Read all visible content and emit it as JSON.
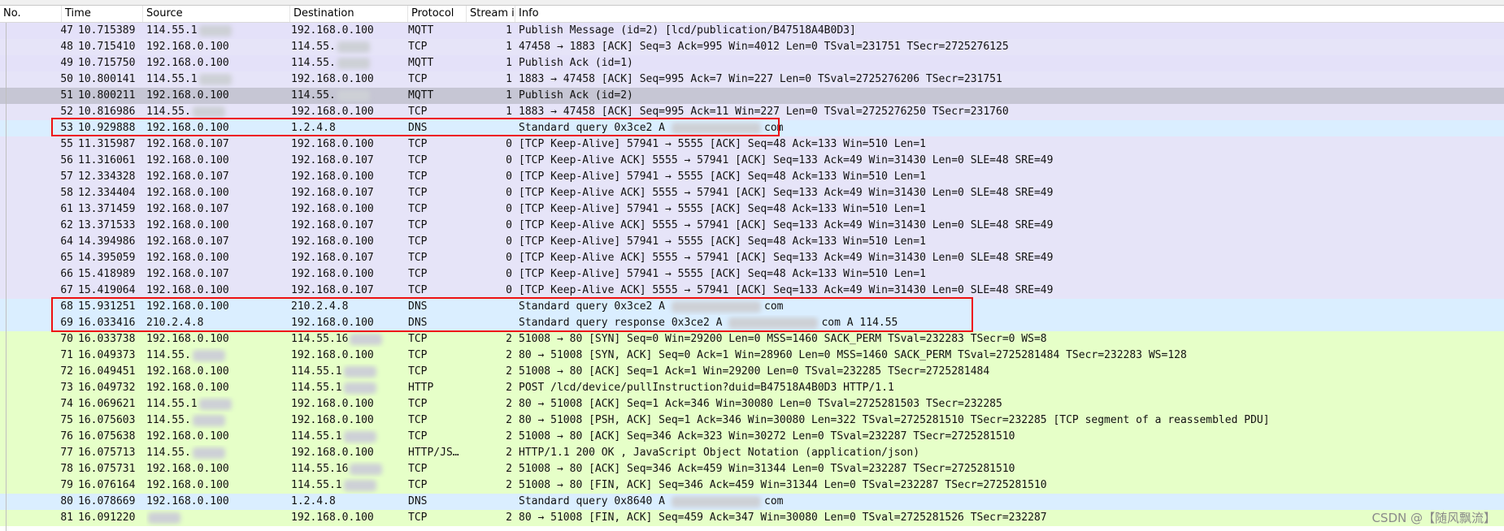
{
  "columns": [
    "No.",
    "Time",
    "Source",
    "Destination",
    "Protocol",
    "Stream in",
    "Info"
  ],
  "packets": [
    {
      "no": "47",
      "time": "10.715389",
      "src": "114.55.1",
      "dst": "192.168.0.100",
      "proto": "MQTT",
      "stream": "1",
      "info": "Publish Message (id=2) [lcd/publication/B47518A4B0D3]",
      "bg": "mqtt",
      "src_blur": true,
      "dst_blur": false
    },
    {
      "no": "48",
      "time": "10.715410",
      "src": "192.168.0.100",
      "dst": "114.55.",
      "proto": "TCP",
      "stream": "1",
      "info": "47458 → 1883 [ACK] Seq=3 Ack=995 Win=4012 Len=0 TSval=231751 TSecr=2725276125",
      "bg": "tcp",
      "src_blur": false,
      "dst_blur": true
    },
    {
      "no": "49",
      "time": "10.715750",
      "src": "192.168.0.100",
      "dst": "114.55.",
      "proto": "MQTT",
      "stream": "1",
      "info": "Publish Ack (id=1)",
      "bg": "mqtt",
      "src_blur": false,
      "dst_blur": true
    },
    {
      "no": "50",
      "time": "10.800141",
      "src": "114.55.1",
      "dst": "192.168.0.100",
      "proto": "TCP",
      "stream": "1",
      "info": "1883 → 47458 [ACK] Seq=995 Ack=7 Win=227 Len=0 TSval=2725276206 TSecr=231751",
      "bg": "tcp",
      "src_blur": true,
      "dst_blur": false
    },
    {
      "no": "51",
      "time": "10.800211",
      "src": "192.168.0.100",
      "dst": "114.55.",
      "proto": "MQTT",
      "stream": "1",
      "info": "Publish Ack (id=2)",
      "bg": "sel",
      "src_blur": false,
      "dst_blur": true
    },
    {
      "no": "52",
      "time": "10.816986",
      "src": "114.55.",
      "dst": "192.168.0.100",
      "proto": "TCP",
      "stream": "1",
      "info": "1883 → 47458 [ACK] Seq=995 Ack=11 Win=227 Len=0 TSval=2725276250 TSecr=231760",
      "bg": "tcp",
      "src_blur": true,
      "dst_blur": false
    },
    {
      "no": "53",
      "time": "10.929888",
      "src": "192.168.0.100",
      "dst": "1.2.4.8",
      "proto": "DNS",
      "stream": "",
      "info": "Standard query 0x3ce2 A",
      "info_tail": "com",
      "bg": "dns",
      "src_blur": false,
      "dst_blur": false,
      "info_blur": true
    },
    {
      "no": "55",
      "time": "11.315987",
      "src": "192.168.0.107",
      "dst": "192.168.0.100",
      "proto": "TCP",
      "stream": "0",
      "info": "[TCP Keep-Alive] 57941 → 5555 [ACK] Seq=48 Ack=133 Win=510 Len=1",
      "bg": "tcp"
    },
    {
      "no": "56",
      "time": "11.316061",
      "src": "192.168.0.100",
      "dst": "192.168.0.107",
      "proto": "TCP",
      "stream": "0",
      "info": "[TCP Keep-Alive ACK] 5555 → 57941 [ACK] Seq=133 Ack=49 Win=31430 Len=0 SLE=48 SRE=49",
      "bg": "tcp"
    },
    {
      "no": "57",
      "time": "12.334328",
      "src": "192.168.0.107",
      "dst": "192.168.0.100",
      "proto": "TCP",
      "stream": "0",
      "info": "[TCP Keep-Alive] 57941 → 5555 [ACK] Seq=48 Ack=133 Win=510 Len=1",
      "bg": "tcp"
    },
    {
      "no": "58",
      "time": "12.334404",
      "src": "192.168.0.100",
      "dst": "192.168.0.107",
      "proto": "TCP",
      "stream": "0",
      "info": "[TCP Keep-Alive ACK] 5555 → 57941 [ACK] Seq=133 Ack=49 Win=31430 Len=0 SLE=48 SRE=49",
      "bg": "tcp"
    },
    {
      "no": "61",
      "time": "13.371459",
      "src": "192.168.0.107",
      "dst": "192.168.0.100",
      "proto": "TCP",
      "stream": "0",
      "info": "[TCP Keep-Alive] 57941 → 5555 [ACK] Seq=48 Ack=133 Win=510 Len=1",
      "bg": "tcp"
    },
    {
      "no": "62",
      "time": "13.371533",
      "src": "192.168.0.100",
      "dst": "192.168.0.107",
      "proto": "TCP",
      "stream": "0",
      "info": "[TCP Keep-Alive ACK] 5555 → 57941 [ACK] Seq=133 Ack=49 Win=31430 Len=0 SLE=48 SRE=49",
      "bg": "tcp"
    },
    {
      "no": "64",
      "time": "14.394986",
      "src": "192.168.0.107",
      "dst": "192.168.0.100",
      "proto": "TCP",
      "stream": "0",
      "info": "[TCP Keep-Alive] 57941 → 5555 [ACK] Seq=48 Ack=133 Win=510 Len=1",
      "bg": "tcp"
    },
    {
      "no": "65",
      "time": "14.395059",
      "src": "192.168.0.100",
      "dst": "192.168.0.107",
      "proto": "TCP",
      "stream": "0",
      "info": "[TCP Keep-Alive ACK] 5555 → 57941 [ACK] Seq=133 Ack=49 Win=31430 Len=0 SLE=48 SRE=49",
      "bg": "tcp"
    },
    {
      "no": "66",
      "time": "15.418989",
      "src": "192.168.0.107",
      "dst": "192.168.0.100",
      "proto": "TCP",
      "stream": "0",
      "info": "[TCP Keep-Alive] 57941 → 5555 [ACK] Seq=48 Ack=133 Win=510 Len=1",
      "bg": "tcp"
    },
    {
      "no": "67",
      "time": "15.419064",
      "src": "192.168.0.100",
      "dst": "192.168.0.107",
      "proto": "TCP",
      "stream": "0",
      "info": "[TCP Keep-Alive ACK] 5555 → 57941 [ACK] Seq=133 Ack=49 Win=31430 Len=0 SLE=48 SRE=49",
      "bg": "tcp"
    },
    {
      "no": "68",
      "time": "15.931251",
      "src": "192.168.0.100",
      "dst": "210.2.4.8",
      "proto": "DNS",
      "stream": "",
      "info": "Standard query 0x3ce2 A",
      "info_tail": "com",
      "bg": "dns",
      "info_blur": true
    },
    {
      "no": "69",
      "time": "16.033416",
      "src": "210.2.4.8",
      "dst": "192.168.0.100",
      "proto": "DNS",
      "stream": "",
      "info": "Standard query response 0x3ce2 A",
      "info_tail": "com A 114.55",
      "bg": "dns",
      "info_blur": true
    },
    {
      "no": "70",
      "time": "16.033738",
      "src": "192.168.0.100",
      "dst": "114.55.16",
      "proto": "TCP",
      "stream": "2",
      "info": "51008 → 80 [SYN] Seq=0 Win=29200 Len=0 MSS=1460 SACK_PERM TSval=232283 TSecr=0 WS=8",
      "bg": "http",
      "dst_blur": true
    },
    {
      "no": "71",
      "time": "16.049373",
      "src": "114.55.",
      "dst": "192.168.0.100",
      "proto": "TCP",
      "stream": "2",
      "info": "80 → 51008 [SYN, ACK] Seq=0 Ack=1 Win=28960 Len=0 MSS=1460 SACK_PERM TSval=2725281484 TSecr=232283 WS=128",
      "bg": "http",
      "src_blur": true
    },
    {
      "no": "72",
      "time": "16.049451",
      "src": "192.168.0.100",
      "dst": "114.55.1",
      "proto": "TCP",
      "stream": "2",
      "info": "51008 → 80 [ACK] Seq=1 Ack=1 Win=29200 Len=0 TSval=232285 TSecr=2725281484",
      "bg": "http",
      "dst_blur": true
    },
    {
      "no": "73",
      "time": "16.049732",
      "src": "192.168.0.100",
      "dst": "114.55.1",
      "proto": "HTTP",
      "stream": "2",
      "info": "POST /lcd/device/pullInstruction?duid=B47518A4B0D3 HTTP/1.1",
      "bg": "http",
      "dst_blur": true
    },
    {
      "no": "74",
      "time": "16.069621",
      "src": "114.55.1",
      "dst": "192.168.0.100",
      "proto": "TCP",
      "stream": "2",
      "info": "80 → 51008 [ACK] Seq=1 Ack=346 Win=30080 Len=0 TSval=2725281503 TSecr=232285",
      "bg": "http",
      "src_blur": true
    },
    {
      "no": "75",
      "time": "16.075603",
      "src": "114.55.",
      "dst": "192.168.0.100",
      "proto": "TCP",
      "stream": "2",
      "info": "80 → 51008 [PSH, ACK] Seq=1 Ack=346 Win=30080 Len=322 TSval=2725281510 TSecr=232285 [TCP segment of a reassembled PDU]",
      "bg": "http",
      "src_blur": true
    },
    {
      "no": "76",
      "time": "16.075638",
      "src": "192.168.0.100",
      "dst": "114.55.1",
      "proto": "TCP",
      "stream": "2",
      "info": "51008 → 80 [ACK] Seq=346 Ack=323 Win=30272 Len=0 TSval=232287 TSecr=2725281510",
      "bg": "http",
      "dst_blur": true
    },
    {
      "no": "77",
      "time": "16.075713",
      "src": "114.55.",
      "dst": "192.168.0.100",
      "proto": "HTTP/JS…",
      "stream": "2",
      "info": "HTTP/1.1 200 OK , JavaScript Object Notation (application/json)",
      "bg": "http",
      "src_blur": true
    },
    {
      "no": "78",
      "time": "16.075731",
      "src": "192.168.0.100",
      "dst": "114.55.16",
      "proto": "TCP",
      "stream": "2",
      "info": "51008 → 80 [ACK] Seq=346 Ack=459 Win=31344 Len=0 TSval=232287 TSecr=2725281510",
      "bg": "http",
      "dst_blur": true
    },
    {
      "no": "79",
      "time": "16.076164",
      "src": "192.168.0.100",
      "dst": "114.55.1",
      "proto": "TCP",
      "stream": "2",
      "info": "51008 → 80 [FIN, ACK] Seq=346 Ack=459 Win=31344 Len=0 TSval=232287 TSecr=2725281510",
      "bg": "http",
      "dst_blur": true
    },
    {
      "no": "80",
      "time": "16.078669",
      "src": "192.168.0.100",
      "dst": "1.2.4.8",
      "proto": "DNS",
      "stream": "",
      "info": "Standard query 0x8640 A",
      "info_tail": "com",
      "bg": "dns",
      "info_blur": true
    },
    {
      "no": "81",
      "time": "16.091220",
      "src": "",
      "dst": "192.168.0.100",
      "proto": "TCP",
      "stream": "2",
      "info": "80 → 51008 [FIN, ACK] Seq=459 Ack=347 Win=30080 Len=0 TSval=2725281526 TSecr=232287",
      "bg": "http",
      "src_blur": true
    }
  ],
  "watermark": "CSDN @【随风飘流】",
  "colors": {
    "highlight": "#e11111"
  }
}
